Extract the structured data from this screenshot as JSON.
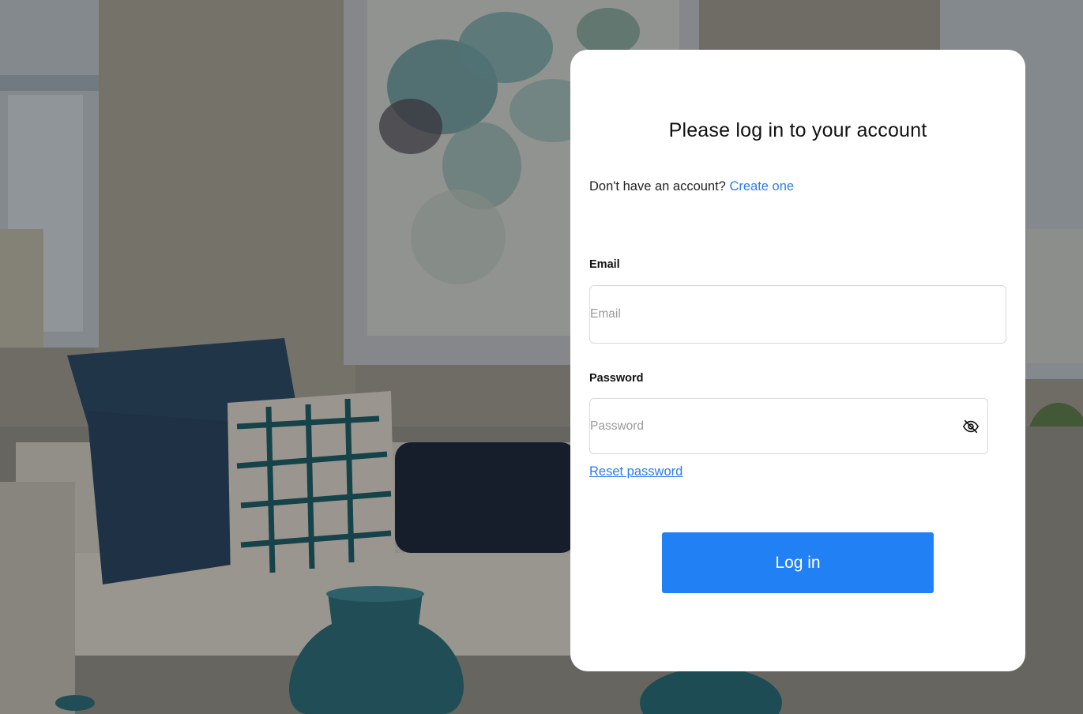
{
  "login_card": {
    "title": "Please log in to your account",
    "signup_prompt": "Don't have an account?",
    "signup_link": "Create one",
    "email_label": "Email",
    "email_placeholder": "Email",
    "email_value": "",
    "password_label": "Password",
    "password_placeholder": "Password",
    "password_value": "",
    "password_toggle_icon": "eye-off-icon",
    "reset_link": "Reset password",
    "login_button": "Log in"
  },
  "colors": {
    "accent": "#2280f5",
    "link": "#2b7de9",
    "card_background": "#ffffff"
  },
  "background": {
    "image_description_icon": "living-room-photo"
  }
}
